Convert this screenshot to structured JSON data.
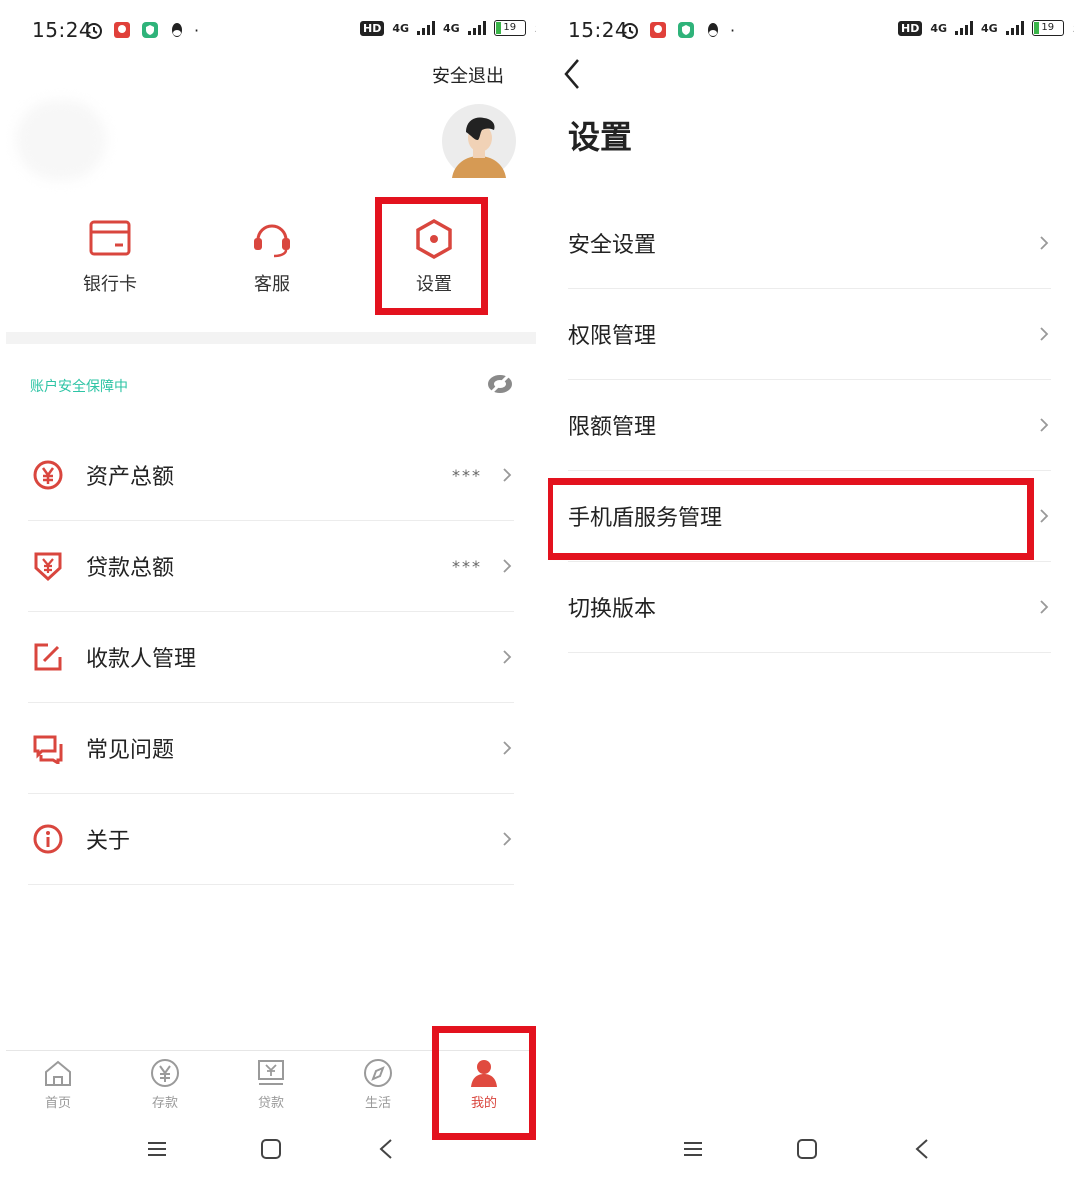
{
  "left": {
    "status": {
      "time": "15:24",
      "network1": "4G",
      "network2": "4G",
      "battery": "19"
    },
    "header": {
      "logout": "安全退出"
    },
    "quick_actions": [
      {
        "label": "银行卡",
        "icon": "bank-card-icon"
      },
      {
        "label": "客服",
        "icon": "headset-icon"
      },
      {
        "label": "设置",
        "icon": "settings-hex-icon"
      }
    ],
    "security_text": "账户安全保障中",
    "menu": [
      {
        "label": "资产总额",
        "value": "***",
        "icon": "yen-circle-icon"
      },
      {
        "label": "贷款总额",
        "value": "***",
        "icon": "loan-shield-icon"
      },
      {
        "label": "收款人管理",
        "value": "",
        "icon": "edit-square-icon"
      },
      {
        "label": "常见问题",
        "value": "",
        "icon": "chat-bubbles-icon"
      },
      {
        "label": "关于",
        "value": "",
        "icon": "info-circle-icon"
      }
    ],
    "tabbar": [
      {
        "label": "首页",
        "icon": "home-icon"
      },
      {
        "label": "存款",
        "icon": "yen-coin-icon"
      },
      {
        "label": "贷款",
        "icon": "loan-screen-icon"
      },
      {
        "label": "生活",
        "icon": "compass-icon"
      },
      {
        "label": "我的",
        "icon": "person-icon"
      }
    ]
  },
  "right": {
    "status": {
      "time": "15:24",
      "network1": "4G",
      "network2": "4G",
      "battery": "19"
    },
    "title": "设置",
    "items": [
      {
        "label": "安全设置"
      },
      {
        "label": "权限管理"
      },
      {
        "label": "限额管理"
      },
      {
        "label": "手机盾服务管理"
      },
      {
        "label": "切换版本"
      }
    ]
  },
  "colors": {
    "accent": "#d9463e",
    "highlight": "#e3121e",
    "security_text": "#2ec4a5",
    "tab_inactive": "#9a9a9a"
  }
}
